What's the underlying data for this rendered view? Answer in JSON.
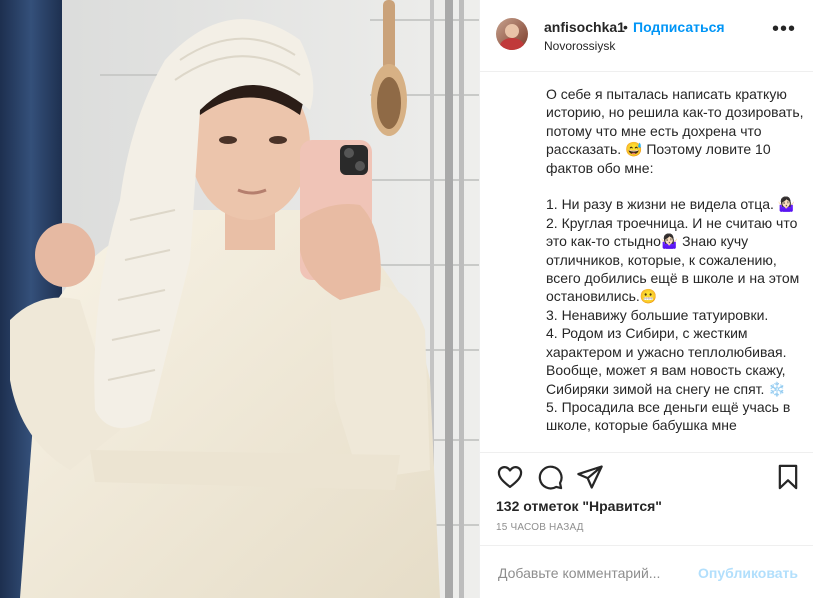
{
  "post": {
    "username": "anfisochka1",
    "separator": "•",
    "follow_label": "Подписаться",
    "location": "Novorossiysk",
    "more_label": "•••",
    "caption": "О себе я пыталась написать краткую историю, но решила как-то дозировать, потому что мне есть дохрена что рассказать. 😅 Поэтому ловите 10 фактов обо мне:\n\n1. Ни разу в жизни не видела отца. 🤷🏻‍♀️\n2. Круглая троечница. И не считаю что это как-то стыдно🤷🏻‍♀️ Знаю кучу отличников, которые, к сожалению, всего добились ещё в школе и на этом остановились.😬\n3. Ненавижу большие татуировки.\n4. Родом из Сибири, с жестким характером и ужасно теплолюбивая. Вообще, может я вам новость скажу, Сибиряки зимой на снегу не спят. ❄️\n5. Просадила все деньги ещё учась в школе, которые бабушка мне",
    "likes_text": "132 отметок \"Нравится\"",
    "time_text": "15 ЧАСОВ НАЗАД"
  },
  "icons": {
    "like": "heart-icon",
    "comment": "comment-icon",
    "share": "share-icon",
    "save": "bookmark-icon"
  },
  "comment_box": {
    "placeholder": "Добавьте комментарий...",
    "publish_label": "Опубликовать"
  },
  "colors": {
    "accent": "#0095f6",
    "publish_disabled": "#b2dffc",
    "muted": "#8e8e8e"
  }
}
